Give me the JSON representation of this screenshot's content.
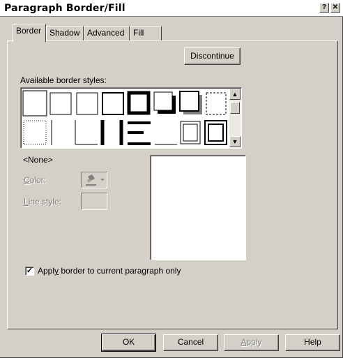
{
  "title": "Paragraph Border/Fill",
  "titlebar": {
    "help_glyph": "?",
    "close_glyph": "✕"
  },
  "tabs": [
    {
      "label": "Border",
      "active": true
    },
    {
      "label": "Shadow",
      "active": false
    },
    {
      "label": "Advanced",
      "active": false
    },
    {
      "label": "Fill",
      "active": false
    }
  ],
  "discontinue_label": "Discontinue",
  "available_label": "Available border styles:",
  "selected_style": "<None>",
  "color_label": "Color:",
  "line_style_label": "Line style:",
  "apply_checkbox": {
    "label": "Apply border to current paragraph only",
    "checked": true,
    "mark": "✓"
  },
  "buttons": {
    "ok": "OK",
    "cancel": "Cancel",
    "apply": "Apply",
    "help": "Help"
  },
  "scroll": {
    "up": "▲",
    "down": "▼"
  },
  "icons": {
    "color_picker": "paint-bucket-icon",
    "dropdown": "▾"
  }
}
